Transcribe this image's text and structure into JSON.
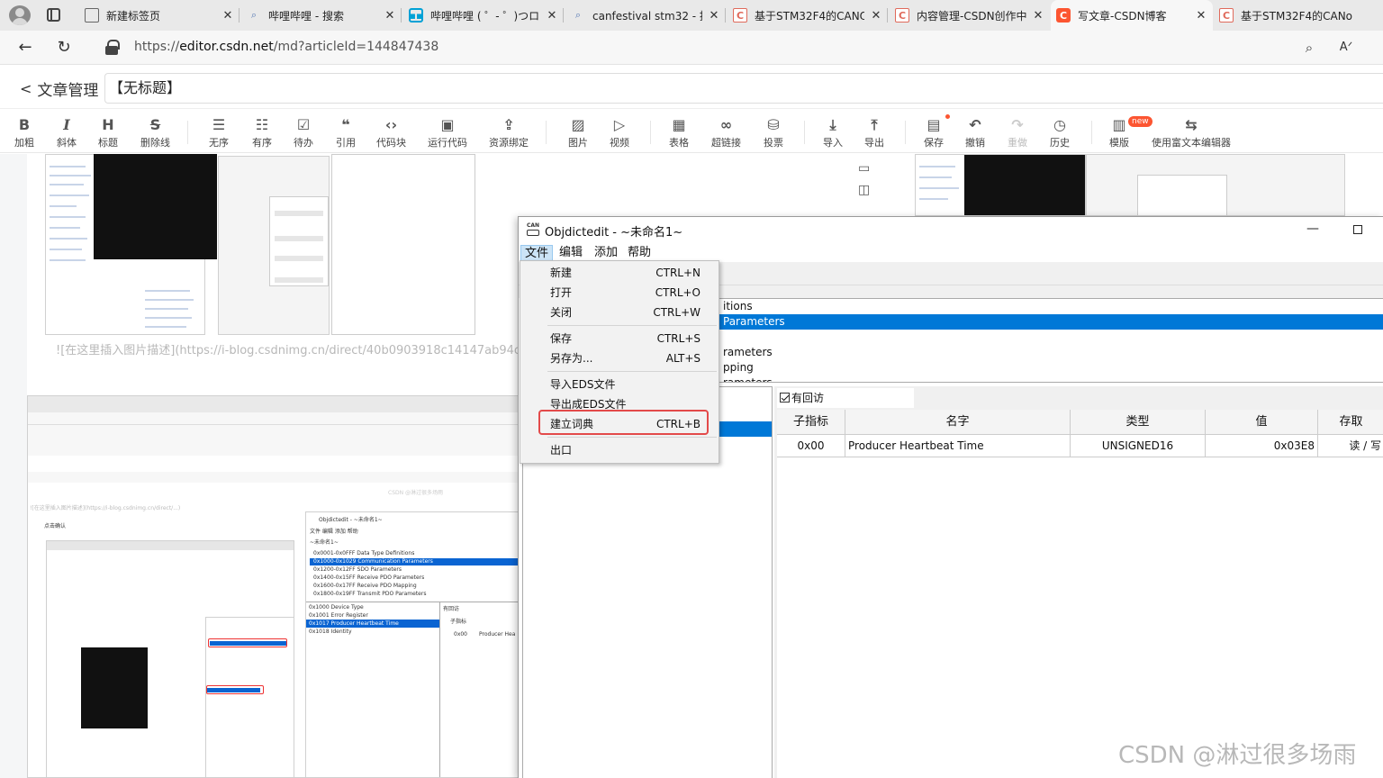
{
  "browser": {
    "tabs": [
      {
        "title": "新建标签页",
        "favicon": "page-icon"
      },
      {
        "title": "哔哩哔哩 - 搜索",
        "favicon": "search-icon"
      },
      {
        "title": "哔哩哔哩 ( ゜- ゜)つロ 乾",
        "favicon": "bilibili-icon"
      },
      {
        "title": "canfestival stm32 - 搜索",
        "favicon": "search-icon"
      },
      {
        "title": "基于STM32F4的CANO",
        "favicon": "csdn-icon"
      },
      {
        "title": "内容管理-CSDN创作中",
        "favicon": "csdn-icon"
      },
      {
        "title": "写文章-CSDN博客",
        "favicon": "csdn-icon"
      },
      {
        "title": "基于STM32F4的CANo",
        "favicon": "csdn-icon"
      }
    ],
    "url_prefix": "https://",
    "url_host": "editor.csdn.net",
    "url_path": "/md?articleId=144847438"
  },
  "editor": {
    "back_label": "文章管理",
    "title_value": "【无标题】",
    "toolbar": [
      {
        "glyph": "B",
        "label": "加粗"
      },
      {
        "glyph": "I",
        "label": "斜体"
      },
      {
        "glyph": "H",
        "label": "标题"
      },
      {
        "glyph": "S",
        "label": "删除线"
      },
      {
        "glyph": "☰",
        "label": "无序"
      },
      {
        "glyph": "☷",
        "label": "有序"
      },
      {
        "glyph": "☑",
        "label": "待办"
      },
      {
        "glyph": "❝",
        "label": "引用"
      },
      {
        "glyph": "‹›",
        "label": "代码块"
      },
      {
        "glyph": "▣",
        "label": "运行代码"
      },
      {
        "glyph": "⇪",
        "label": "资源绑定"
      },
      {
        "glyph": "▨",
        "label": "图片"
      },
      {
        "glyph": "▷",
        "label": "视频"
      },
      {
        "glyph": "▦",
        "label": "表格"
      },
      {
        "glyph": "∞",
        "label": "超链接"
      },
      {
        "glyph": "⛁",
        "label": "投票"
      },
      {
        "glyph": "⤓",
        "label": "导入"
      },
      {
        "glyph": "⤒",
        "label": "导出"
      },
      {
        "glyph": "▤",
        "label": "保存"
      },
      {
        "glyph": "↶",
        "label": "撤销"
      },
      {
        "glyph": "↷",
        "label": "重做"
      },
      {
        "glyph": "◷",
        "label": "历史"
      },
      {
        "glyph": "▥",
        "label": "模版"
      },
      {
        "glyph": "⇆",
        "label": "使用富文本编辑器"
      }
    ],
    "new_badge": "new",
    "image_placeholder_line": "![在这里插入图片描述](https://i-blog.csdnimg.cn/direct/40b0903918c14147ab94c1d3c",
    "watermark": "CSDN @淋过很多场雨"
  },
  "thumb": {
    "texts": {
      "t1": "0x0001-0x0FFF  Data Type Definitions",
      "t2": "0x1000-0x1029  Communication Parameters",
      "t3": "0x1200-0x12FF  SDO Parameters",
      "t4": "0x1400-0x15FF  Receive PDO Parameters",
      "t5": "0x1600-0x17FF  Receive PDO Mapping",
      "t6": "0x1800-0x19FF  Transmit PDO Parameters",
      "t7": "0x1000  Device Type",
      "t8": "0x1001  Error Register",
      "t9": "0x1017  Producer Heartbeat Time",
      "t10": "0x1018  Identity",
      "t11": "Objdictedit - ~未命名1~",
      "t12": "文件  编辑  添加  帮助",
      "t13": "点击确认",
      "t14": "CSDN @淋过很多场雨",
      "t15": "0x00",
      "t16": "Producer Hea",
      "t17": "有回访",
      "t18": "子指标",
      "t19": "~未命名1~"
    }
  },
  "objdictedit": {
    "title": "Objdictedit - ~未命名1~",
    "menus": [
      "文件",
      "编辑",
      "添加",
      "帮助"
    ],
    "file_menu": [
      {
        "label": "新建",
        "shortcut": "CTRL+N"
      },
      {
        "label": "打开",
        "shortcut": "CTRL+O"
      },
      {
        "label": "关闭",
        "shortcut": "CTRL+W"
      },
      {
        "label": "保存",
        "shortcut": "CTRL+S"
      },
      {
        "label": "另存为...",
        "shortcut": "ALT+S"
      },
      {
        "label": "导入EDS文件",
        "shortcut": ""
      },
      {
        "label": "导出成EDS文件",
        "shortcut": ""
      },
      {
        "label": "建立词典",
        "shortcut": "CTRL+B"
      },
      {
        "label": "出口",
        "shortcut": ""
      }
    ],
    "range_list": [
      "itions",
      "Parameters",
      "",
      "rameters",
      "pping",
      "rameters"
    ],
    "checkbox_label": "有回访",
    "columns": [
      "子指标",
      "名字",
      "类型",
      "值",
      "存取"
    ],
    "rows": [
      {
        "subindex": "0x00",
        "name": "Producer Heartbeat Time",
        "type": "UNSIGNED16",
        "value": "0x03E8",
        "access": "读 / 写"
      }
    ]
  }
}
